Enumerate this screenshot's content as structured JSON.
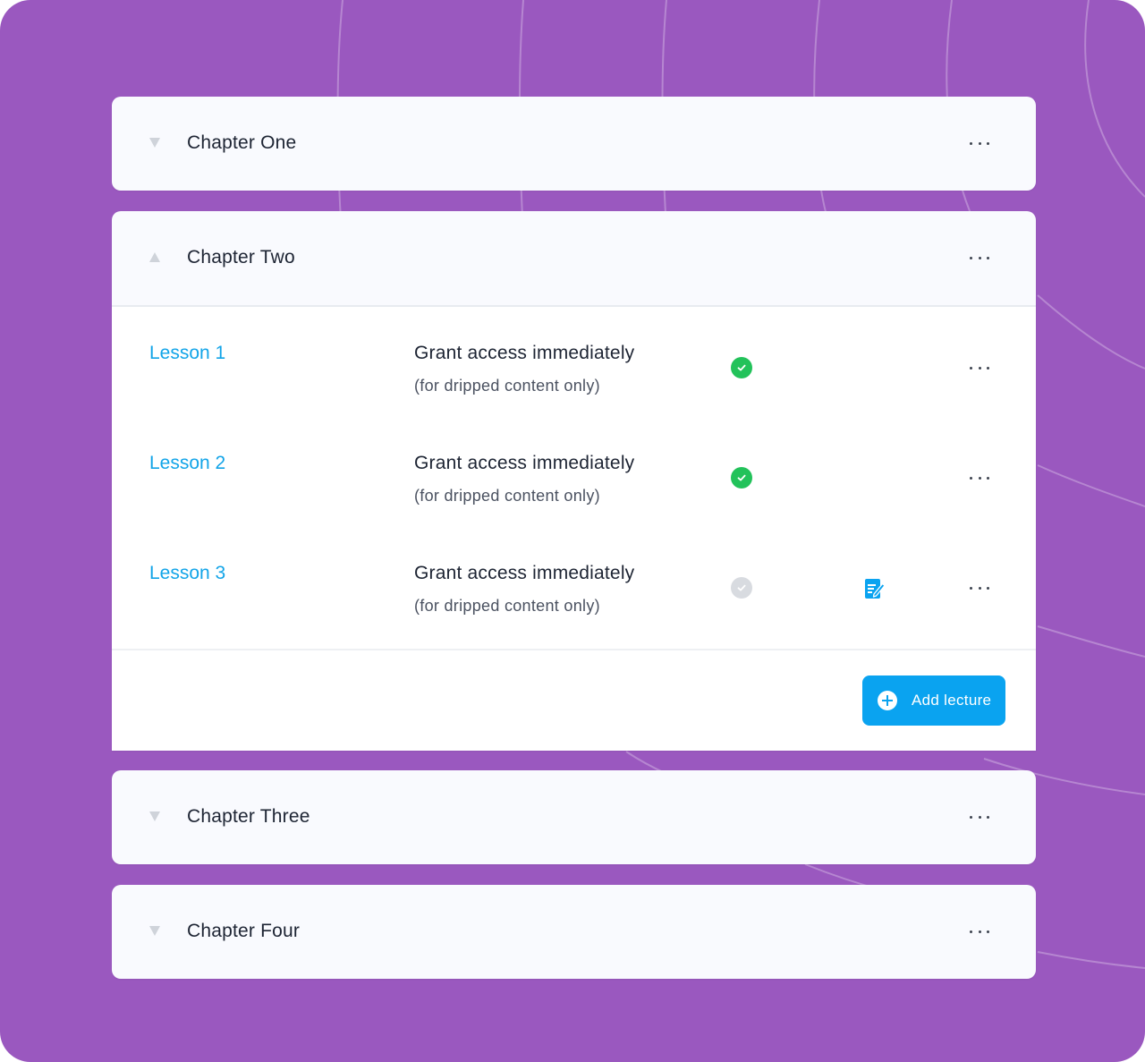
{
  "colors": {
    "background": "#9a58bf",
    "accent": "#0aa3f0",
    "lesson_link": "#12a4e8",
    "check_on": "#22c25a",
    "check_off": "#d8dbe0"
  },
  "chapters": [
    {
      "title": "Chapter One",
      "state": "collapsed",
      "caret_icon": "caret-down-icon",
      "menu_icon": "more-icon"
    },
    {
      "title": "Chapter Two",
      "state": "expanded",
      "caret_icon": "caret-up-icon",
      "menu_icon": "more-icon",
      "lessons": [
        {
          "name": "Lesson 1",
          "access_title": "Grant access immediately",
          "access_subtitle": "(for dripped content only)",
          "enabled": true,
          "status_icon": "check-circle-icon",
          "menu_icon": "more-icon"
        },
        {
          "name": "Lesson 2",
          "access_title": "Grant access immediately",
          "access_subtitle": "(for dripped content only)",
          "enabled": true,
          "status_icon": "check-circle-icon",
          "menu_icon": "more-icon"
        },
        {
          "name": "Lesson 3",
          "access_title": "Grant access immediately",
          "access_subtitle": "(for dripped content only)",
          "enabled": false,
          "status_icon": "check-circle-icon",
          "extra_icon": "edit-note-icon",
          "menu_icon": "more-icon"
        }
      ],
      "add_button": {
        "label": "Add lecture",
        "icon": "plus-circle-icon"
      }
    },
    {
      "title": "Chapter Three",
      "state": "collapsed",
      "caret_icon": "caret-down-icon",
      "menu_icon": "more-icon"
    },
    {
      "title": "Chapter Four",
      "state": "collapsed",
      "caret_icon": "caret-down-icon",
      "menu_icon": "more-icon"
    }
  ]
}
